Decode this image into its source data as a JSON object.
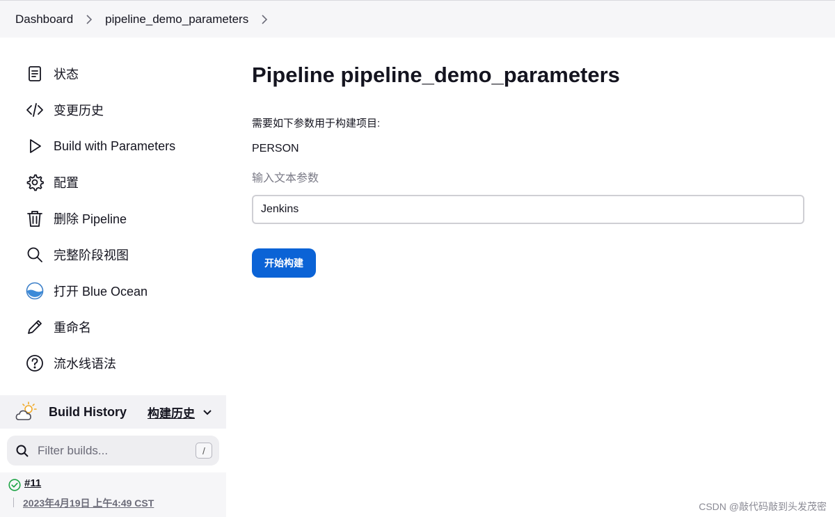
{
  "breadcrumb": {
    "items": [
      "Dashboard",
      "pipeline_demo_parameters"
    ]
  },
  "sidebar": {
    "tasks": [
      {
        "label": "状态",
        "icon": "status-document-icon"
      },
      {
        "label": "变更历史",
        "icon": "code-changes-icon"
      },
      {
        "label": "Build with Parameters",
        "icon": "play-icon"
      },
      {
        "label": "配置",
        "icon": "gear-icon"
      },
      {
        "label": "删除 Pipeline",
        "icon": "trash-icon"
      },
      {
        "label": "完整阶段视图",
        "icon": "search-icon"
      },
      {
        "label": "打开 Blue Ocean",
        "icon": "blue-ocean-icon"
      },
      {
        "label": "重命名",
        "icon": "pencil-icon"
      },
      {
        "label": "流水线语法",
        "icon": "help-circle-icon"
      }
    ]
  },
  "build_history": {
    "title": "Build History",
    "link": "构建历史",
    "weather_icon": "partly-cloudy-weather-icon",
    "filter_placeholder": "Filter builds...",
    "shortcut": "/",
    "builds": [
      {
        "number": "#11",
        "date": "2023年4月19日 上午4:49 CST",
        "status": "success"
      }
    ]
  },
  "main": {
    "title": "Pipeline pipeline_demo_parameters",
    "intro": "需要如下参数用于构建项目:",
    "param_name": "PERSON",
    "param_description": "输入文本参数",
    "param_value": "Jenkins",
    "build_button": "开始构建"
  },
  "watermark": "CSDN @敲代码敲到头发茂密",
  "colors": {
    "accent": "#0b63d6",
    "success": "#1ea446",
    "breadcrumb_bg": "#f6f6f8"
  }
}
